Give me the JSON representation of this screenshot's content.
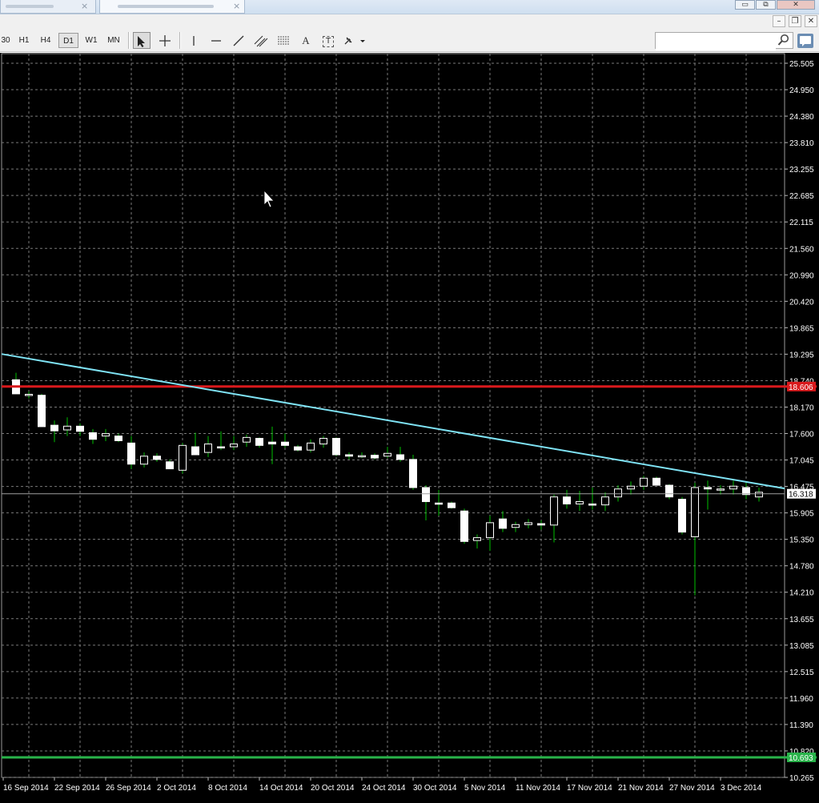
{
  "window": {
    "tabs": [
      {
        "label": "",
        "close": "×"
      },
      {
        "label": "",
        "close": "×"
      }
    ],
    "controls": {
      "minimize": "▭",
      "restore": "⧉",
      "close": "✕"
    },
    "inner_controls": {
      "minimize": "–",
      "restore": "❐",
      "close": "✕"
    }
  },
  "toolbar": {
    "timeframes": [
      "30",
      "H1",
      "H4",
      "D1",
      "W1",
      "MN"
    ],
    "active_timeframe": "D1",
    "tools": [
      {
        "name": "cursor-icon",
        "active": true
      },
      {
        "name": "crosshair-icon",
        "active": false
      },
      {
        "name": "vertical-line-icon",
        "active": false
      },
      {
        "name": "horizontal-line-icon",
        "active": false
      },
      {
        "name": "trendline-icon",
        "active": false
      },
      {
        "name": "equidistant-channel-icon",
        "active": false
      },
      {
        "name": "fibonacci-icon",
        "active": false
      },
      {
        "name": "text-icon",
        "active": false
      },
      {
        "name": "text-label-icon",
        "active": false
      },
      {
        "name": "arrows-dropdown-icon",
        "active": false
      }
    ],
    "text_tool_label": "A",
    "text_label_tool_label": "T",
    "search_placeholder": ""
  },
  "chart_data": {
    "type": "candlestick",
    "x_labels": [
      "16 Sep 2014",
      "22 Sep 2014",
      "26 Sep 2014",
      "2 Oct 2014",
      "8 Oct 2014",
      "14 Oct 2014",
      "20 Oct 2014",
      "24 Oct 2014",
      "30 Oct 2014",
      "5 Nov 2014",
      "11 Nov 2014",
      "17 Nov 2014",
      "21 Nov 2014",
      "27 Nov 2014",
      "3 Dec 2014"
    ],
    "y_ticks": [
      "25.505",
      "24.950",
      "24.380",
      "23.810",
      "23.255",
      "22.685",
      "22.115",
      "21.560",
      "20.990",
      "20.420",
      "19.865",
      "19.295",
      "18.740",
      "18.170",
      "17.600",
      "17.045",
      "16.475",
      "15.905",
      "15.350",
      "14.780",
      "14.210",
      "13.655",
      "13.085",
      "12.515",
      "11.960",
      "11.390",
      "10.820",
      "10.265"
    ],
    "ylim": [
      10.265,
      25.505
    ],
    "grid": true,
    "colors": {
      "background": "#000000",
      "grid": "#7a7a7a",
      "bull_fill": "#000000",
      "bear_fill": "#ffffff",
      "candle_outline": "#ffffff",
      "wick": "#00c000",
      "trendline": "#7fe3f5",
      "resistance": "#d9191c",
      "support": "#29b34a",
      "price_line": "#a0a0a0"
    },
    "horizontal_lines": [
      {
        "label": "18.606",
        "value": 18.606,
        "color": "#d9191c"
      },
      {
        "label": "10.693",
        "value": 10.693,
        "color": "#29b34a"
      }
    ],
    "current_price": {
      "label": "16.318",
      "value": 16.318
    },
    "trendline": {
      "start": {
        "date": "16 Sep 2014",
        "value": 19.3
      },
      "end": {
        "date": "8 Dec 2014",
        "value": 16.43
      }
    },
    "candles": [
      {
        "o": 18.75,
        "h": 18.9,
        "l": 18.55,
        "c": 18.45
      },
      {
        "o": 18.42,
        "h": 18.5,
        "l": 18.35,
        "c": 18.44
      },
      {
        "o": 18.42,
        "h": 18.45,
        "l": 17.75,
        "c": 17.75
      },
      {
        "o": 17.78,
        "h": 17.88,
        "l": 17.42,
        "c": 17.66
      },
      {
        "o": 17.68,
        "h": 17.95,
        "l": 17.55,
        "c": 17.76
      },
      {
        "o": 17.76,
        "h": 17.82,
        "l": 17.55,
        "c": 17.65
      },
      {
        "o": 17.62,
        "h": 17.7,
        "l": 17.38,
        "c": 17.48
      },
      {
        "o": 17.55,
        "h": 17.7,
        "l": 17.44,
        "c": 17.6
      },
      {
        "o": 17.55,
        "h": 17.6,
        "l": 17.42,
        "c": 17.45
      },
      {
        "o": 17.4,
        "h": 17.55,
        "l": 16.85,
        "c": 16.95
      },
      {
        "o": 16.95,
        "h": 17.2,
        "l": 16.88,
        "c": 17.12
      },
      {
        "o": 17.12,
        "h": 17.18,
        "l": 17.0,
        "c": 17.05
      },
      {
        "o": 17.0,
        "h": 17.05,
        "l": 16.85,
        "c": 16.85
      },
      {
        "o": 16.82,
        "h": 17.4,
        "l": 16.75,
        "c": 17.35
      },
      {
        "o": 17.32,
        "h": 17.62,
        "l": 17.15,
        "c": 17.15
      },
      {
        "o": 17.2,
        "h": 17.55,
        "l": 17.1,
        "c": 17.38
      },
      {
        "o": 17.32,
        "h": 17.65,
        "l": 17.25,
        "c": 17.3
      },
      {
        "o": 17.32,
        "h": 17.55,
        "l": 17.25,
        "c": 17.38
      },
      {
        "o": 17.42,
        "h": 17.58,
        "l": 17.32,
        "c": 17.52
      },
      {
        "o": 17.5,
        "h": 17.52,
        "l": 17.3,
        "c": 17.35
      },
      {
        "o": 17.42,
        "h": 17.75,
        "l": 16.95,
        "c": 17.38
      },
      {
        "o": 17.42,
        "h": 17.6,
        "l": 17.3,
        "c": 17.35
      },
      {
        "o": 17.32,
        "h": 17.36,
        "l": 17.22,
        "c": 17.25
      },
      {
        "o": 17.25,
        "h": 17.48,
        "l": 17.2,
        "c": 17.4
      },
      {
        "o": 17.38,
        "h": 17.55,
        "l": 17.3,
        "c": 17.5
      },
      {
        "o": 17.5,
        "h": 17.52,
        "l": 17.12,
        "c": 17.15
      },
      {
        "o": 17.15,
        "h": 17.2,
        "l": 17.05,
        "c": 17.12
      },
      {
        "o": 17.12,
        "h": 17.2,
        "l": 17.08,
        "c": 17.13
      },
      {
        "o": 17.14,
        "h": 17.18,
        "l": 17.05,
        "c": 17.08
      },
      {
        "o": 17.12,
        "h": 17.32,
        "l": 17.08,
        "c": 17.18
      },
      {
        "o": 17.15,
        "h": 17.32,
        "l": 17.0,
        "c": 17.05
      },
      {
        "o": 17.05,
        "h": 17.15,
        "l": 16.4,
        "c": 16.45
      },
      {
        "o": 16.45,
        "h": 16.5,
        "l": 15.75,
        "c": 16.15
      },
      {
        "o": 16.12,
        "h": 16.4,
        "l": 15.85,
        "c": 16.1
      },
      {
        "o": 16.12,
        "h": 16.15,
        "l": 16.0,
        "c": 16.02
      },
      {
        "o": 15.95,
        "h": 16.0,
        "l": 15.25,
        "c": 15.3
      },
      {
        "o": 15.32,
        "h": 15.45,
        "l": 15.15,
        "c": 15.38
      },
      {
        "o": 15.38,
        "h": 15.85,
        "l": 15.1,
        "c": 15.7
      },
      {
        "o": 15.78,
        "h": 15.95,
        "l": 15.5,
        "c": 15.58
      },
      {
        "o": 15.6,
        "h": 15.72,
        "l": 15.5,
        "c": 15.66
      },
      {
        "o": 15.66,
        "h": 15.78,
        "l": 15.58,
        "c": 15.7
      },
      {
        "o": 15.68,
        "h": 15.75,
        "l": 15.55,
        "c": 15.65
      },
      {
        "o": 15.65,
        "h": 16.3,
        "l": 15.28,
        "c": 16.25
      },
      {
        "o": 16.25,
        "h": 16.4,
        "l": 16.0,
        "c": 16.1
      },
      {
        "o": 16.1,
        "h": 16.38,
        "l": 15.95,
        "c": 16.15
      },
      {
        "o": 16.1,
        "h": 16.45,
        "l": 15.98,
        "c": 16.08
      },
      {
        "o": 16.08,
        "h": 16.35,
        "l": 15.95,
        "c": 16.25
      },
      {
        "o": 16.25,
        "h": 16.5,
        "l": 16.15,
        "c": 16.42
      },
      {
        "o": 16.42,
        "h": 16.58,
        "l": 16.3,
        "c": 16.48
      },
      {
        "o": 16.48,
        "h": 16.7,
        "l": 16.4,
        "c": 16.65
      },
      {
        "o": 16.65,
        "h": 16.68,
        "l": 16.5,
        "c": 16.5
      },
      {
        "o": 16.5,
        "h": 16.52,
        "l": 16.2,
        "c": 16.25
      },
      {
        "o": 16.2,
        "h": 16.25,
        "l": 15.45,
        "c": 15.5
      },
      {
        "o": 15.4,
        "h": 16.55,
        "l": 14.15,
        "c": 16.45
      },
      {
        "o": 16.45,
        "h": 16.6,
        "l": 15.98,
        "c": 16.42
      },
      {
        "o": 16.4,
        "h": 16.5,
        "l": 16.3,
        "c": 16.42
      },
      {
        "o": 16.42,
        "h": 16.6,
        "l": 16.3,
        "c": 16.48
      },
      {
        "o": 16.45,
        "h": 16.55,
        "l": 16.2,
        "c": 16.3
      },
      {
        "o": 16.25,
        "h": 16.45,
        "l": 16.15,
        "c": 16.35
      }
    ]
  }
}
